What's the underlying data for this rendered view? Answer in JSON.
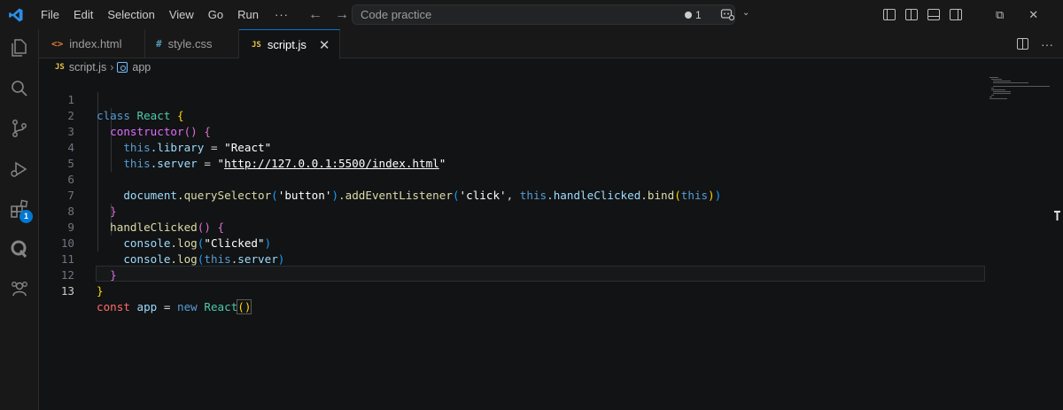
{
  "menu": [
    "File",
    "Edit",
    "Selection",
    "View",
    "Go",
    "Run"
  ],
  "menu_more": "···",
  "command_center": {
    "text": "Code practice",
    "count": "1"
  },
  "tabs": [
    {
      "icon": "<>",
      "label": "index.html",
      "icon_color": "#e37933"
    },
    {
      "icon": "#",
      "label": "style.css",
      "icon_color": "#519aba"
    },
    {
      "icon": "JS",
      "label": "script.js",
      "icon_color": "#e8c34a"
    }
  ],
  "breadcrumb": {
    "file": "script.js",
    "symbol": "app"
  },
  "activity_badge": "1",
  "line_numbers": [
    "1",
    "2",
    "3",
    "4",
    "5",
    "6",
    "7",
    "8",
    "9",
    "10",
    "11",
    "12",
    "13"
  ],
  "code": {
    "l1_kw": "class",
    "l1_name": "React",
    "l1_brace": "{",
    "l2_fn": "constructor",
    "l2_paren": "()",
    "l2_brace": "{",
    "l3_this": "this",
    "l3_prop": ".library",
    "l3_eq": " = ",
    "l3_str": "\"React\"",
    "l4_this": "this",
    "l4_prop": ".server",
    "l4_eq": " = ",
    "l4_q1": "\"",
    "l4_url": "http://127.0.0.1:5500/index.html",
    "l4_q2": "\"",
    "l6_obj": "document",
    "l6_m1": ".querySelector",
    "l6_p1": "(",
    "l6_s1": "'button'",
    "l6_p2": ")",
    "l6_m2": ".addEventListener",
    "l6_p3": "(",
    "l6_s2": "'click'",
    "l6_comma": ", ",
    "l6_this": "this",
    "l6_m3": ".handleClicked",
    "l6_m4": ".bind",
    "l6_p4": "(",
    "l6_this2": "this",
    "l6_p5": ")",
    "l6_p6": ")",
    "l7_brace": "}",
    "l8_fn": "handleClicked",
    "l8_paren": "()",
    "l8_brace": "{",
    "l9_obj": "console",
    "l9_m": ".log",
    "l9_p1": "(",
    "l9_str": "\"Clicked\"",
    "l9_p2": ")",
    "l10_obj": "console",
    "l10_m": ".log",
    "l10_p1": "(",
    "l10_this": "this",
    "l10_prop": ".server",
    "l10_p2": ")",
    "l11_brace": "}",
    "l12_brace": "}",
    "l13_kw": "const",
    "l13_var": "app",
    "l13_eq": " = ",
    "l13_new": "new",
    "l13_cls": "React",
    "l13_paren": "()"
  }
}
